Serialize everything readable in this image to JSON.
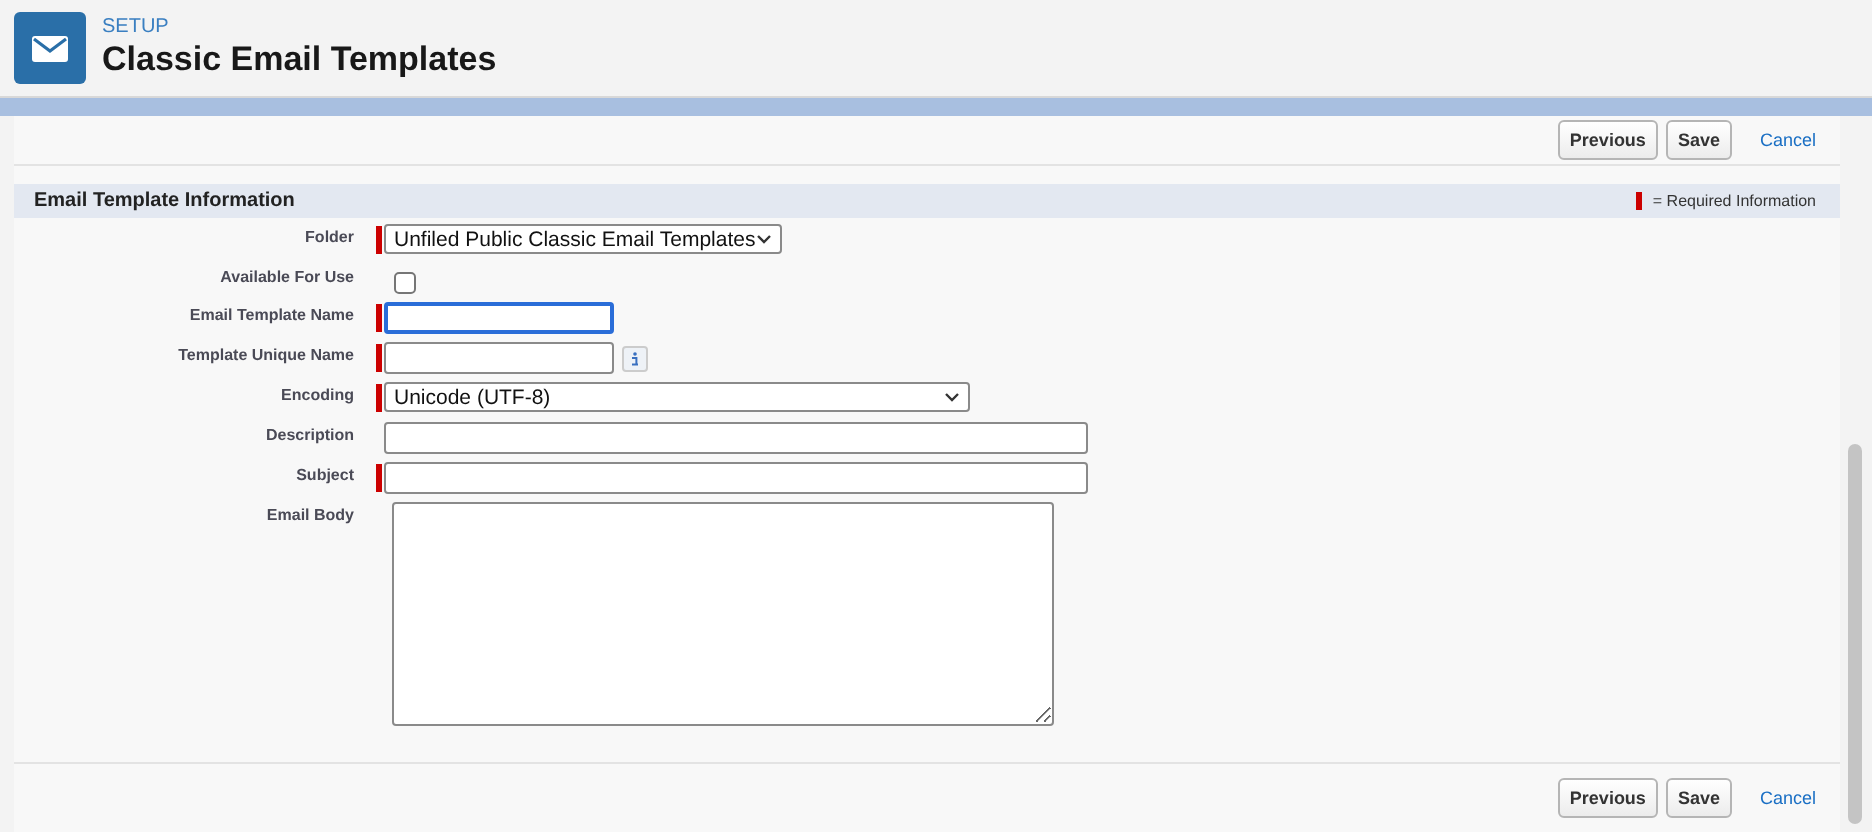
{
  "header": {
    "eyebrow": "SETUP",
    "title": "Classic Email Templates"
  },
  "top_buttons": [
    {
      "label": "Previous",
      "kind": "button"
    },
    {
      "label": "Save",
      "kind": "button"
    },
    {
      "label": "Cancel",
      "kind": "link"
    }
  ],
  "section": {
    "title": "Email Template Information",
    "legend": "= Required Information"
  },
  "fields": [
    {
      "label": "Folder",
      "kind": "select",
      "required": true,
      "value": "Unfiled Public Classic Email Templates"
    },
    {
      "label": "Available For Use",
      "kind": "checkbox",
      "required": false,
      "checked": false
    },
    {
      "label": "Email Template Name",
      "kind": "text",
      "required": true,
      "focused": true,
      "info": false
    },
    {
      "label": "Template Unique Name",
      "kind": "text",
      "required": true,
      "focused": false,
      "info": true
    },
    {
      "label": "Encoding",
      "kind": "select",
      "required": true,
      "value": "Unicode (UTF-8)"
    },
    {
      "label": "Description",
      "kind": "text",
      "required": false,
      "focused": false,
      "info": false
    },
    {
      "label": "Subject",
      "kind": "text",
      "required": true,
      "focused": false,
      "info": false
    },
    {
      "label": "Email Body",
      "kind": "textarea",
      "required": false
    }
  ],
  "bottom_buttons": [
    {
      "label": "Previous",
      "kind": "button"
    },
    {
      "label": "Save",
      "kind": "button"
    },
    {
      "label": "Cancel",
      "kind": "link"
    }
  ]
}
